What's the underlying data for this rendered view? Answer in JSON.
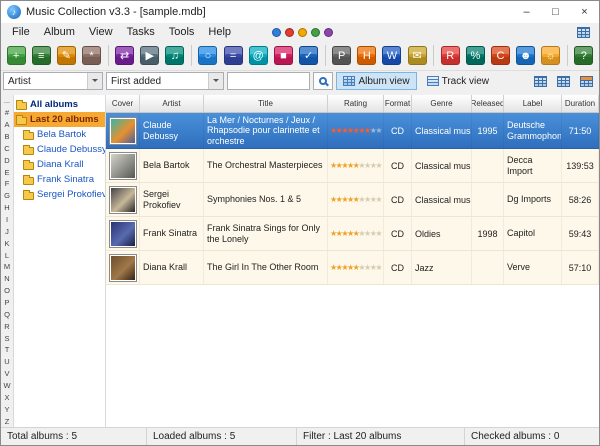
{
  "window": {
    "title": "Music Collection v3.3 - [sample.mdb]",
    "icon_glyph": "♪",
    "controls": {
      "minimize": "–",
      "maximize": "□",
      "close": "×"
    }
  },
  "menu": {
    "items": [
      "File",
      "Album",
      "View",
      "Tasks",
      "Tools",
      "Help"
    ],
    "flags": [
      "#2f7de1",
      "#e23b2f",
      "#f5a800",
      "#43a047",
      "#8e44ad"
    ]
  },
  "toolbar": {
    "icons": [
      {
        "name": "new-album",
        "glyph": "+",
        "color": "#3fa13f"
      },
      {
        "name": "add-albums-from-disc",
        "glyph": "≡",
        "color": "#2e7d32"
      },
      {
        "name": "edit-album",
        "glyph": "✎",
        "color": "#e08a00"
      },
      {
        "name": "batch-update",
        "glyph": "*",
        "color": "#8d6e63"
      },
      {
        "sep": true
      },
      {
        "name": "loan-manager",
        "glyph": "⇄",
        "color": "#7b1fa2"
      },
      {
        "name": "cd-player",
        "glyph": "▶",
        "color": "#546e7a"
      },
      {
        "name": "music-player",
        "glyph": "♫",
        "color": "#00897b"
      },
      {
        "sep": true
      },
      {
        "name": "search",
        "glyph": "○",
        "color": "#1e88e5"
      },
      {
        "name": "advanced-search",
        "glyph": "=",
        "color": "#3949ab"
      },
      {
        "name": "internet-lookup",
        "glyph": "@",
        "color": "#00acc1"
      },
      {
        "name": "covers-browser",
        "glyph": "■",
        "color": "#d81b60"
      },
      {
        "name": "check-albums",
        "glyph": "✓",
        "color": "#1565c0"
      },
      {
        "sep": true
      },
      {
        "name": "print",
        "glyph": "P",
        "color": "#616161"
      },
      {
        "name": "html-export",
        "glyph": "H",
        "color": "#ef6c00"
      },
      {
        "name": "export-word",
        "glyph": "W",
        "color": "#1a57c2"
      },
      {
        "name": "send-email",
        "glyph": "✉",
        "color": "#c9a227"
      },
      {
        "sep": true
      },
      {
        "name": "reports",
        "glyph": "R",
        "color": "#e53935"
      },
      {
        "name": "statistics",
        "glyph": "%",
        "color": "#00796b"
      },
      {
        "name": "loan-calendar",
        "glyph": "C",
        "color": "#d84315"
      },
      {
        "name": "contacts",
        "glyph": "☻",
        "color": "#1976d2"
      },
      {
        "name": "preferences",
        "glyph": "☼",
        "color": "#f9a825"
      },
      {
        "sep": true
      },
      {
        "name": "help",
        "glyph": "?",
        "color": "#2e7d32"
      }
    ]
  },
  "filterbar": {
    "field_value": "Artist",
    "mode_value": "First added",
    "search_value": "",
    "album_view": "Album view",
    "track_view": "Track view"
  },
  "alpha": [
    "...",
    "#",
    "A",
    "B",
    "C",
    "D",
    "E",
    "F",
    "G",
    "H",
    "I",
    "J",
    "K",
    "L",
    "M",
    "N",
    "O",
    "P",
    "Q",
    "R",
    "S",
    "T",
    "U",
    "V",
    "W",
    "X",
    "Y",
    "Z"
  ],
  "sidebar": {
    "tree": [
      {
        "label": "All albums"
      },
      {
        "label": "Last 20 albums",
        "selected": true
      },
      {
        "label": "Bela Bartok"
      },
      {
        "label": "Claude Debussy"
      },
      {
        "label": "Diana Krall"
      },
      {
        "label": "Frank Sinatra"
      },
      {
        "label": "Sergei Prokofiev"
      }
    ]
  },
  "table": {
    "columns": [
      "Cover",
      "Artist",
      "Title",
      "Rating",
      "Format",
      "Genre",
      "Released",
      "Label",
      "Duration"
    ],
    "rows": [
      {
        "artist": "Claude Debussy",
        "title": "La Mer / Nocturnes / Jeux / Rhapsodie pour clarinette et orchestre",
        "rating": {
          "filled": 7,
          "total": 9
        },
        "format": "CD",
        "genre": "Classical music",
        "released": "1995",
        "label": "Deutsche Grammophon",
        "duration": "71:50",
        "selected": true,
        "cover": [
          "#28b8b0",
          "#e89030",
          "#3858a8"
        ]
      },
      {
        "artist": "Bela Bartok",
        "title": "The Orchestral Masterpieces",
        "rating": {
          "filled": 5,
          "total": 9
        },
        "format": "CD",
        "genre": "Classical music",
        "released": "",
        "label": "Decca Import",
        "duration": "139:53",
        "cover": [
          "#d8d8d0",
          "#90908a",
          "#50504a"
        ]
      },
      {
        "artist": "Sergei Prokofiev",
        "title": "Symphonies Nos. 1 & 5",
        "rating": {
          "filled": 5,
          "total": 9
        },
        "format": "CD",
        "genre": "Classical music",
        "released": "",
        "label": "Dg Imports",
        "duration": "58:26",
        "cover": [
          "#3a3a42",
          "#c8b898",
          "#17171d"
        ]
      },
      {
        "artist": "Frank Sinatra",
        "title": "Frank Sinatra Sings for Only the Lonely",
        "rating": {
          "filled": 5,
          "total": 9
        },
        "format": "CD",
        "genre": "Oldies",
        "released": "1998",
        "label": "Capitol",
        "duration": "59:43",
        "cover": [
          "#23306e",
          "#5a6ab0",
          "#101838"
        ]
      },
      {
        "artist": "Diana Krall",
        "title": "The Girl In The Other Room",
        "rating": {
          "filled": 5,
          "total": 9
        },
        "format": "CD",
        "genre": "Jazz",
        "released": "",
        "label": "Verve",
        "duration": "57:10",
        "cover": [
          "#6a4a2e",
          "#a07848",
          "#2a1a0e"
        ]
      }
    ]
  },
  "statusbar": {
    "total": "Total albums : 5",
    "loaded": "Loaded albums : 5",
    "filter": "Filter : Last 20 albums",
    "checked": "Checked albums : 0"
  }
}
